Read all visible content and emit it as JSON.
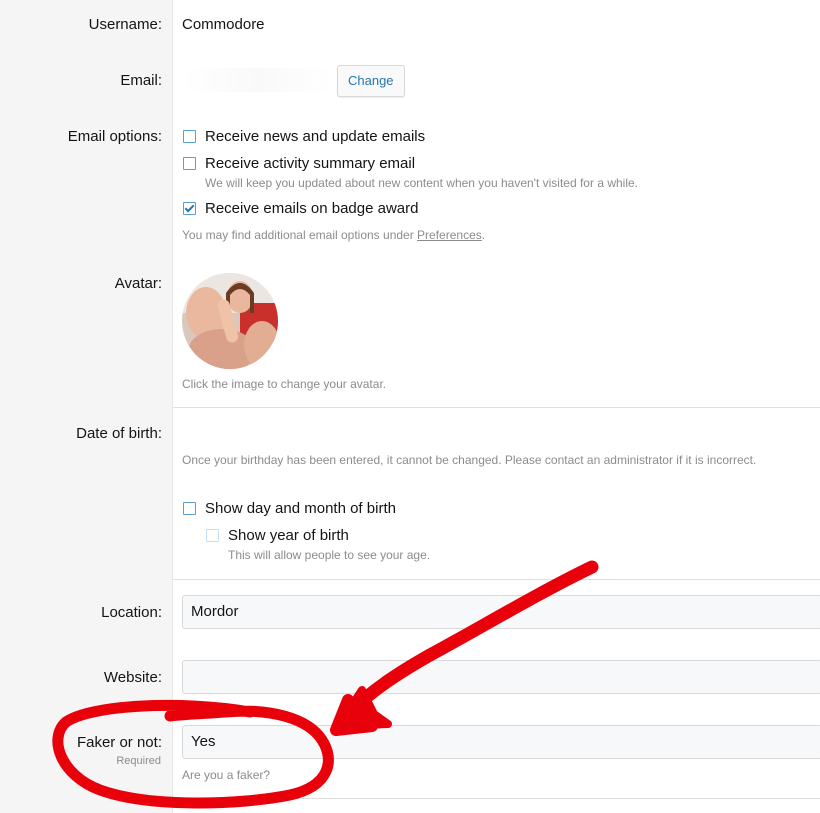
{
  "form": {
    "username": {
      "label": "Username:",
      "value": "Commodore"
    },
    "email": {
      "label": "Email:",
      "change_button": "Change"
    },
    "email_options": {
      "label": "Email options:",
      "options": [
        {
          "label": "Receive news and update emails",
          "checked": false
        },
        {
          "label": "Receive activity summary email",
          "checked": false,
          "hint": "We will keep you updated about new content when you haven't visited for a while."
        },
        {
          "label": "Receive emails on badge award",
          "checked": true
        }
      ],
      "footer_prefix": "You may find additional email options under ",
      "footer_link": "Preferences",
      "footer_suffix": "."
    },
    "avatar": {
      "label": "Avatar:",
      "hint": "Click the image to change your avatar."
    },
    "dob": {
      "label": "Date of birth:",
      "hint": "Once your birthday has been entered, it cannot be changed. Please contact an administrator if it is incorrect.",
      "show_day_month": {
        "label": "Show day and month of birth",
        "checked": false
      },
      "show_year": {
        "label": "Show year of birth",
        "checked": false,
        "hint": "This will allow people to see your age."
      }
    },
    "location": {
      "label": "Location:",
      "value": "Mordor"
    },
    "website": {
      "label": "Website:",
      "value": ""
    },
    "faker": {
      "label": "Faker or not:",
      "required": "Required",
      "value": "Yes",
      "hint": "Are you a faker?"
    }
  },
  "colors": {
    "annotation": "#e8000b",
    "link": "#2577b1",
    "checkbox": "#5a9fd6"
  }
}
